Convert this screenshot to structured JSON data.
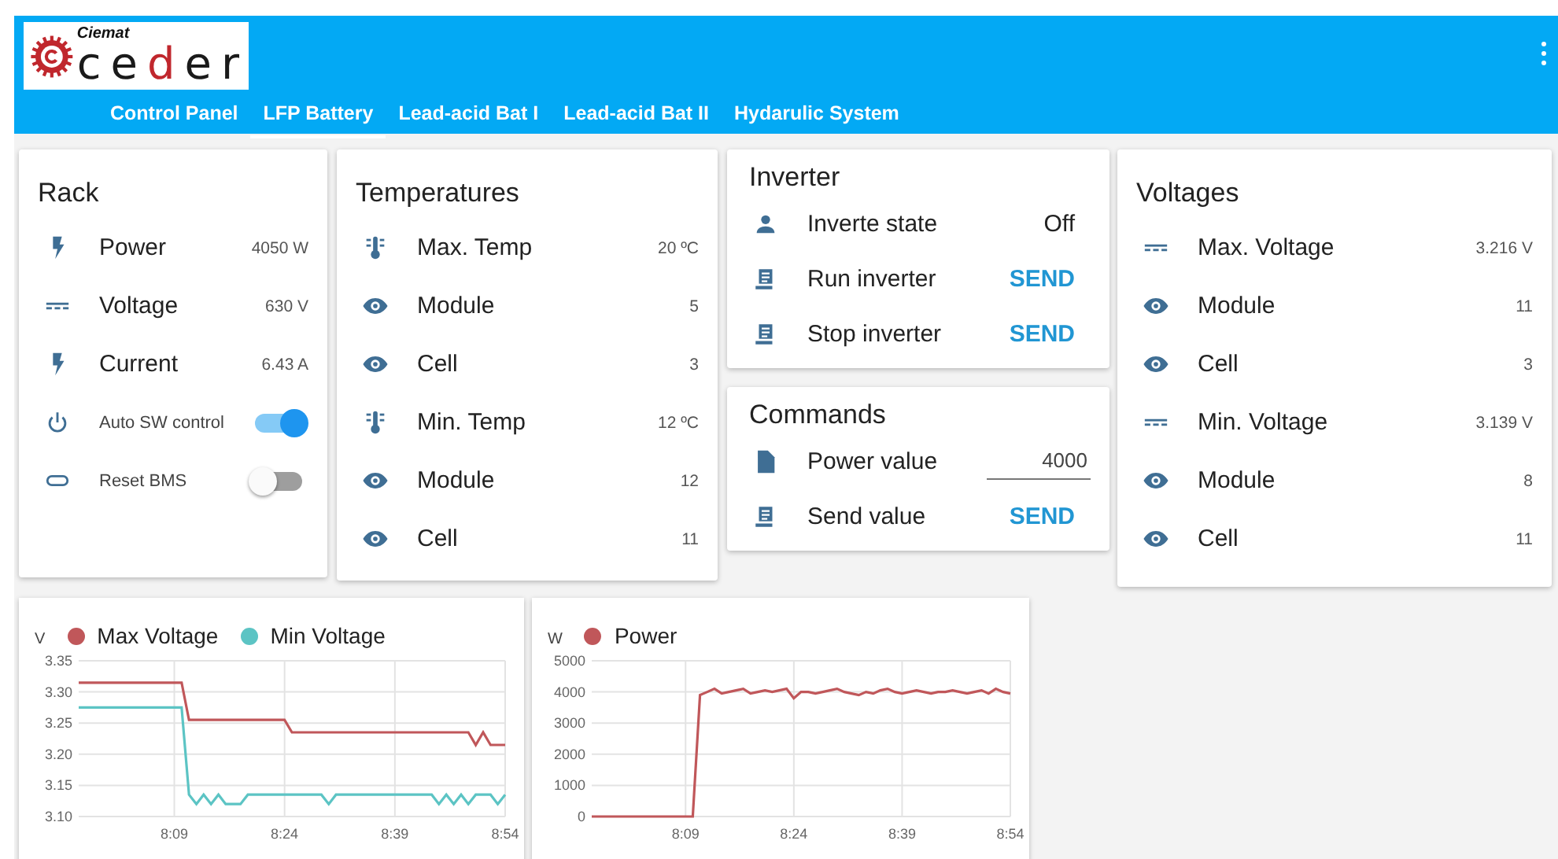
{
  "header": {
    "logo": {
      "top": "Ciemat",
      "parts": [
        {
          "text": "ce",
          "color": "#1a1a1a"
        },
        {
          "text": "d",
          "color": "#c0272d"
        },
        {
          "text": "er",
          "color": "#1a1a1a"
        }
      ]
    },
    "tabs": [
      {
        "label": "Control Panel",
        "selected": false
      },
      {
        "label": "LFP Battery",
        "selected": true
      },
      {
        "label": "Lead-acid Bat I",
        "selected": false
      },
      {
        "label": "Lead-acid Bat II",
        "selected": false
      },
      {
        "label": "Hydarulic System",
        "selected": false
      }
    ]
  },
  "columns": [
    {
      "cards": [
        {
          "title": "Rack",
          "rows": [
            {
              "kind": "energy",
              "label": "Power",
              "value": "4050 W"
            },
            {
              "kind": "voltage",
              "label": "Voltage",
              "value": "630 V"
            },
            {
              "kind": "energy",
              "label": "Current",
              "value": "6.43 A"
            },
            {
              "kind": "auto",
              "label": "Auto SW control",
              "on": true
            },
            {
              "kind": "reset",
              "label": "Reset BMS",
              "on": false
            }
          ]
        }
      ]
    },
    {
      "cards": [
        {
          "title": "Temperatures",
          "rows": [
            {
              "kind": "temperature",
              "label": "Max. Temp",
              "value": "20 ºC"
            },
            {
              "kind": "sensor",
              "label": "Module",
              "value": "5"
            },
            {
              "kind": "sensor",
              "label": "Cell",
              "value": "3"
            },
            {
              "kind": "temperature",
              "label": "Min.  Temp",
              "value": "12 ºC"
            },
            {
              "kind": "sensor",
              "label": "Module",
              "value": "12"
            },
            {
              "kind": "sensor",
              "label": "Cell",
              "value": "11"
            }
          ]
        }
      ]
    },
    {
      "cards": [
        {
          "title": "Inverter",
          "rows": [
            {
              "kind": "status",
              "label": "Inverte state",
              "value": "Off"
            },
            {
              "kind": "command",
              "label": "Run inverter",
              "action": "SEND"
            },
            {
              "kind": "command",
              "label": "Stop inverter",
              "action": "SEND"
            }
          ]
        },
        {
          "title": "Commands",
          "rows": [
            {
              "kind": "input",
              "label": "Power value",
              "value": "4000"
            },
            {
              "kind": "command",
              "label": "Send value",
              "action": "SEND"
            }
          ]
        }
      ]
    },
    {
      "cards": [
        {
          "title": "Voltages",
          "rows": [
            {
              "kind": "voltage",
              "label": "Max. Voltage",
              "value": "3.216 V"
            },
            {
              "kind": "sensor",
              "label": "Module",
              "value": "11"
            },
            {
              "kind": "sensor",
              "label": "Cell",
              "value": "3"
            },
            {
              "kind": "voltage",
              "label": "Min.  Voltage",
              "value": "3.139 V"
            },
            {
              "kind": "sensor",
              "label": "Module",
              "value": "8"
            },
            {
              "kind": "sensor",
              "label": "Cell",
              "value": "11"
            }
          ]
        }
      ]
    }
  ],
  "charts": [
    {
      "chart_data": {
        "type": "line",
        "ylabel": "V",
        "ylim": [
          3.1,
          3.35
        ],
        "yticks": [
          {
            "value": 3.1,
            "label": "3.10"
          },
          {
            "value": 3.15,
            "label": "3.15"
          },
          {
            "value": 3.2,
            "label": "3.20"
          },
          {
            "value": 3.25,
            "label": "3.25"
          },
          {
            "value": 3.3,
            "label": "3.30"
          },
          {
            "value": 3.35,
            "label": "3.35"
          }
        ],
        "grid": true,
        "xlim": [
          476,
          534
        ],
        "xticks": [
          {
            "value": 489,
            "label": "8:09"
          },
          {
            "value": 504,
            "label": "8:24"
          },
          {
            "value": 519,
            "label": "8:39"
          },
          {
            "value": 534,
            "label": "8:54"
          }
        ],
        "x": [
          476,
          477,
          478,
          479,
          480,
          481,
          482,
          483,
          484,
          485,
          486,
          487,
          488,
          489,
          490,
          491,
          492,
          493,
          494,
          495,
          496,
          497,
          498,
          499,
          500,
          501,
          502,
          503,
          504,
          505,
          506,
          507,
          508,
          509,
          510,
          511,
          512,
          513,
          514,
          515,
          516,
          517,
          518,
          519,
          520,
          521,
          522,
          523,
          524,
          525,
          526,
          527,
          528,
          529,
          530,
          531,
          532,
          533,
          534
        ],
        "series": [
          {
            "name": "Max Voltage",
            "color": "#c0575a",
            "values": [
              3.315,
              3.315,
              3.315,
              3.315,
              3.315,
              3.315,
              3.315,
              3.315,
              3.315,
              3.315,
              3.315,
              3.315,
              3.315,
              3.315,
              3.315,
              3.255,
              3.255,
              3.255,
              3.255,
              3.255,
              3.255,
              3.255,
              3.255,
              3.255,
              3.255,
              3.255,
              3.255,
              3.255,
              3.255,
              3.235,
              3.235,
              3.235,
              3.235,
              3.235,
              3.235,
              3.235,
              3.235,
              3.235,
              3.235,
              3.235,
              3.235,
              3.235,
              3.235,
              3.235,
              3.235,
              3.235,
              3.235,
              3.235,
              3.235,
              3.235,
              3.235,
              3.235,
              3.235,
              3.235,
              3.215,
              3.235,
              3.215,
              3.215,
              3.215
            ]
          },
          {
            "name": "Min Voltage",
            "color": "#5cc4c4",
            "values": [
              3.275,
              3.275,
              3.275,
              3.275,
              3.275,
              3.275,
              3.275,
              3.275,
              3.275,
              3.275,
              3.275,
              3.275,
              3.275,
              3.275,
              3.275,
              3.135,
              3.12,
              3.135,
              3.12,
              3.135,
              3.12,
              3.12,
              3.12,
              3.135,
              3.135,
              3.135,
              3.135,
              3.135,
              3.135,
              3.135,
              3.135,
              3.135,
              3.135,
              3.135,
              3.12,
              3.135,
              3.135,
              3.135,
              3.135,
              3.135,
              3.135,
              3.135,
              3.135,
              3.135,
              3.135,
              3.135,
              3.135,
              3.135,
              3.135,
              3.12,
              3.135,
              3.12,
              3.135,
              3.12,
              3.135,
              3.135,
              3.135,
              3.12,
              3.135
            ]
          }
        ]
      }
    },
    {
      "chart_data": {
        "type": "line",
        "ylabel": "W",
        "ylim": [
          0,
          5000
        ],
        "yticks": [
          {
            "value": 0,
            "label": "0"
          },
          {
            "value": 1000,
            "label": "1000"
          },
          {
            "value": 2000,
            "label": "2000"
          },
          {
            "value": 3000,
            "label": "3000"
          },
          {
            "value": 4000,
            "label": "4000"
          },
          {
            "value": 5000,
            "label": "5000"
          }
        ],
        "grid": true,
        "xlim": [
          476,
          534
        ],
        "xticks": [
          {
            "value": 489,
            "label": "8:09"
          },
          {
            "value": 504,
            "label": "8:24"
          },
          {
            "value": 519,
            "label": "8:39"
          },
          {
            "value": 534,
            "label": "8:54"
          }
        ],
        "x": [
          476,
          477,
          478,
          479,
          480,
          481,
          482,
          483,
          484,
          485,
          486,
          487,
          488,
          489,
          490,
          491,
          492,
          493,
          494,
          495,
          496,
          497,
          498,
          499,
          500,
          501,
          502,
          503,
          504,
          505,
          506,
          507,
          508,
          509,
          510,
          511,
          512,
          513,
          514,
          515,
          516,
          517,
          518,
          519,
          520,
          521,
          522,
          523,
          524,
          525,
          526,
          527,
          528,
          529,
          530,
          531,
          532,
          533,
          534
        ],
        "series": [
          {
            "name": "Power",
            "color": "#c0575a",
            "values": [
              0,
              0,
              0,
              0,
              0,
              0,
              0,
              0,
              0,
              0,
              0,
              0,
              0,
              0,
              0,
              3900,
              4000,
              4100,
              3950,
              4000,
              4050,
              4100,
              3950,
              4000,
              4050,
              4000,
              4050,
              4100,
              3800,
              4000,
              4000,
              3950,
              4000,
              4050,
              4100,
              4000,
              3950,
              3900,
              4000,
              3950,
              4050,
              4100,
              4000,
              3950,
              4000,
              4050,
              4000,
              3950,
              4000,
              4000,
              4050,
              4000,
              3950,
              4000,
              4050,
              3950,
              4100,
              4000,
              3950
            ]
          }
        ]
      }
    }
  ]
}
